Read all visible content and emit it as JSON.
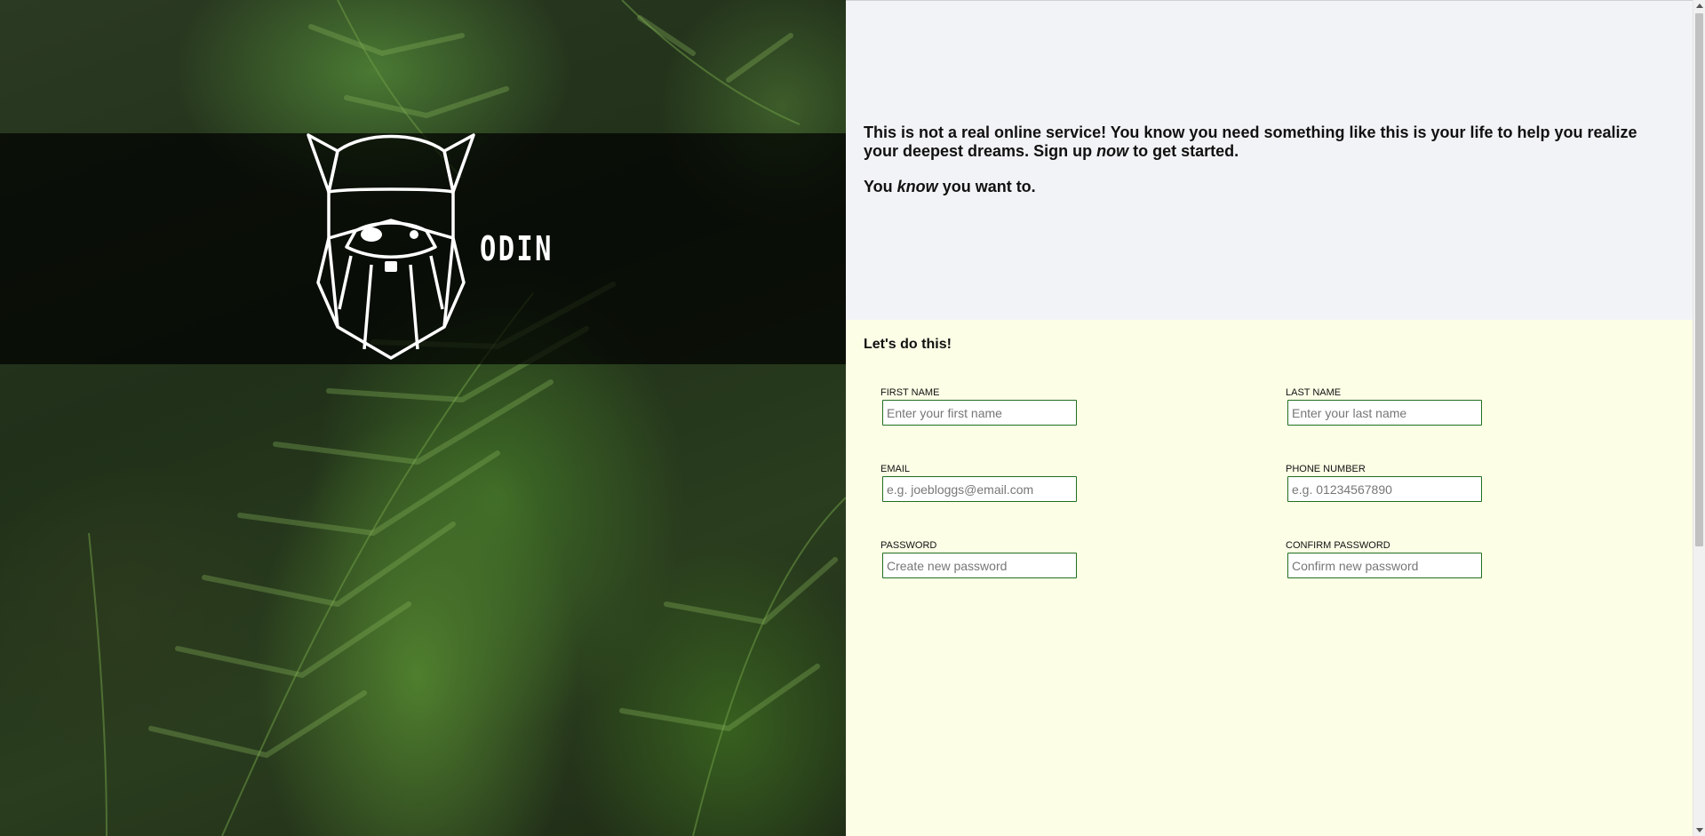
{
  "hero": {
    "brand": "ODIN",
    "logo_icon": "odin-viking-head-icon"
  },
  "intro": {
    "line1_a": "This is not a real online service! You know you need something like this is your life to help you realize your deepest dreams. Sign up ",
    "line1_em": "now",
    "line1_b": " to get started.",
    "line2_a": "You ",
    "line2_em": "know",
    "line2_b": " you want to."
  },
  "form": {
    "title": "Let's do this!",
    "fields": {
      "first_name": {
        "label": "FIRST NAME",
        "placeholder": "Enter your first name",
        "value": ""
      },
      "last_name": {
        "label": "LAST NAME",
        "placeholder": "Enter your last name",
        "value": ""
      },
      "email": {
        "label": "EMAIL",
        "placeholder": "e.g. joebloggs@email.com",
        "value": ""
      },
      "phone": {
        "label": "PHONE NUMBER",
        "placeholder": "e.g. 01234567890",
        "value": ""
      },
      "password": {
        "label": "PASSWORD",
        "placeholder": "Create new password",
        "value": ""
      },
      "confirm_password": {
        "label": "CONFIRM PASSWORD",
        "placeholder": "Confirm new password",
        "value": ""
      }
    },
    "field_border_color": "#1f6f1f",
    "background_color": "#fdfee6"
  },
  "intro_background_color": "#f2f3f6"
}
